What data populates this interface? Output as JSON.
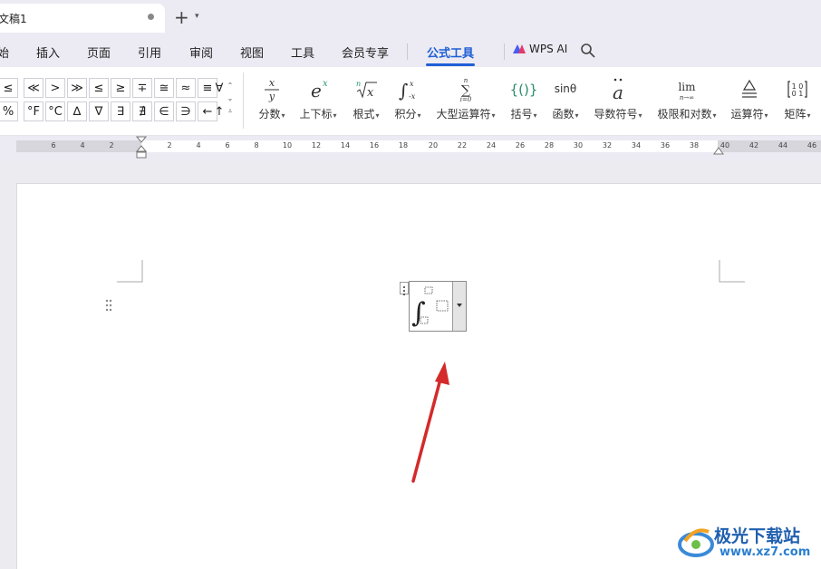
{
  "tabs": {
    "doc_title": "文稿1",
    "new_tab": "+",
    "tab_menu": "⌄"
  },
  "menu": {
    "items": [
      "始",
      "插入",
      "页面",
      "引用",
      "审阅",
      "视图",
      "工具",
      "会员专享",
      "公式工具"
    ],
    "active": "公式工具",
    "wps_ai": "WPS AI"
  },
  "ribbon": {
    "symbols_row1": [
      "≤",
      "≪",
      ">",
      "≫",
      "≤",
      "≥",
      "∓",
      "≅",
      "≈",
      "≡",
      "∀"
    ],
    "symbols_row2": [
      "%",
      "°F",
      "°C",
      "∆",
      "∇",
      "∃",
      "∄",
      "∈",
      "∋",
      "←",
      "↑"
    ],
    "tools": [
      {
        "label": "分数",
        "icon": "x/y"
      },
      {
        "label": "上下标",
        "icon": "eˣ"
      },
      {
        "label": "根式",
        "icon": "ⁿ√x"
      },
      {
        "label": "积分",
        "icon": "∫"
      },
      {
        "label": "大型运算符",
        "icon": "∑"
      },
      {
        "label": "括号",
        "icon": "{()}"
      },
      {
        "label": "函数",
        "icon": "sinθ"
      },
      {
        "label": "导数符号",
        "icon": "ä"
      },
      {
        "label": "极限和对数",
        "icon": "lim"
      },
      {
        "label": "运算符",
        "icon": "≜"
      },
      {
        "label": "矩阵",
        "icon": "[10/01]"
      }
    ]
  },
  "ruler": {
    "left_numbers": [
      "6",
      "4",
      "2"
    ],
    "right_numbers": [
      "2",
      "4",
      "6",
      "8",
      "10",
      "12",
      "14",
      "16",
      "18",
      "20",
      "22",
      "24",
      "26",
      "28",
      "30",
      "32",
      "34",
      "36",
      "38",
      "40",
      "42",
      "44",
      "46"
    ]
  },
  "watermark": {
    "name": "极光下载站",
    "url": "www.xz7.com"
  },
  "colors": {
    "accent": "#1f5fd6",
    "arrow": "#d42a2a"
  }
}
